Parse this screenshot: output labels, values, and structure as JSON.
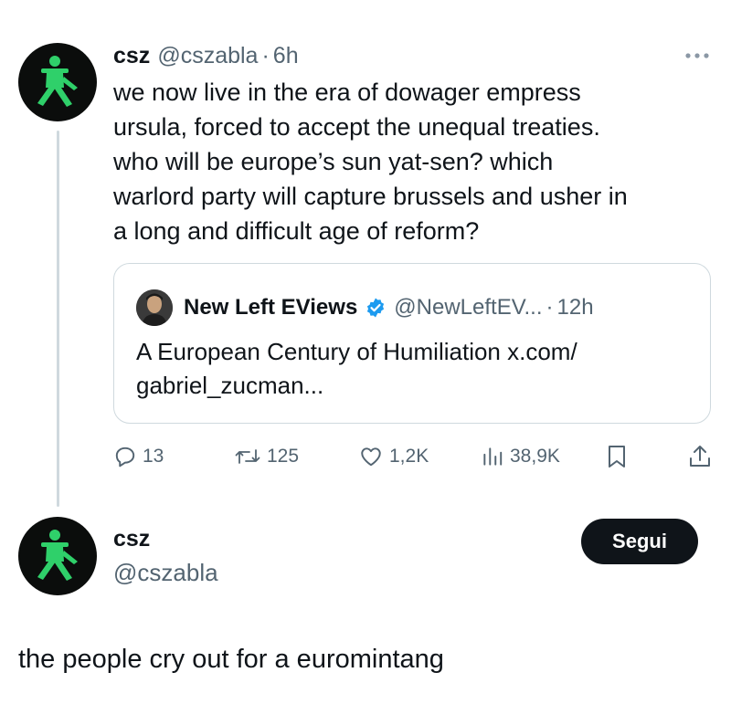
{
  "tweet": {
    "display_name": "csz",
    "handle": "@cszabla",
    "separator": "·",
    "time": "6h",
    "lines": [
      "we now live in the era of dowager empress",
      "ursula, forced to accept the unequal treaties.",
      "who will be europe’s sun yat-sen? which",
      "warlord party will capture brussels and usher in",
      "a long and difficult age of reform?"
    ],
    "more_icon": "more-horizontal-icon"
  },
  "quote": {
    "display_name": "New Left EViews",
    "handle": "@NewLeftEV...",
    "separator": "·",
    "time": "12h",
    "verified_color": "#1d9bf0",
    "lines": [
      "A European Century of Humiliation x.com/",
      "gabriel_zucman..."
    ]
  },
  "actions": {
    "replies": "13",
    "reposts": "125",
    "likes": "1,2K",
    "views": "38,9K"
  },
  "profile": {
    "display_name": "csz",
    "handle": "@cszabla",
    "follow_label": "Segui"
  },
  "reply_text": "the people cry out for a euromintang",
  "colors": {
    "text": "#0f1419",
    "muted": "#536471",
    "border": "#cfd9de",
    "avatar_figure": "#2fd06a"
  }
}
